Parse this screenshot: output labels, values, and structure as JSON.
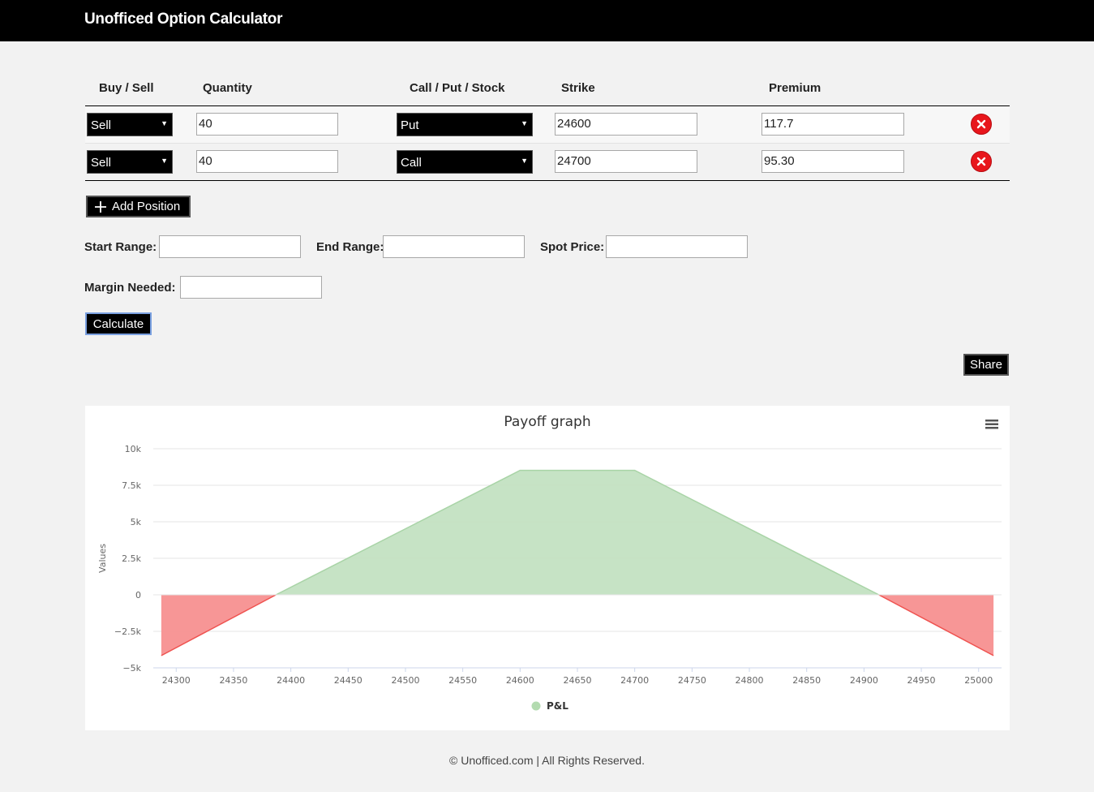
{
  "app": {
    "title": "Unofficed Option Calculator"
  },
  "table": {
    "headers": [
      "Buy / Sell",
      "Quantity",
      "Call / Put / Stock",
      "Strike",
      "Premium"
    ],
    "rows": [
      {
        "side": "Sell",
        "quantity": "40",
        "type": "Put",
        "strike": "24600",
        "premium": "117.7"
      },
      {
        "side": "Sell",
        "quantity": "40",
        "type": "Call",
        "strike": "24700",
        "premium": "95.30"
      }
    ]
  },
  "controls": {
    "add_position": "Add Position",
    "start_range": "Start Range:",
    "end_range": "End Range:",
    "spot_price": "Spot Price:",
    "margin_needed": "Margin Needed:",
    "calculate": "Calculate",
    "share": "Share"
  },
  "colors": {
    "profit": "#c3e1c2",
    "profit_line": "#a9d4a7",
    "loss": "#f79090",
    "loss_line": "#ef5350",
    "legend_dot": "#b3dbb0"
  },
  "chart_data": {
    "type": "area",
    "title": "Payoff graph",
    "ylabel": "Values",
    "xlim": [
      24280,
      25020
    ],
    "ylim": [
      -5000,
      10000
    ],
    "x_ticks": [
      24300,
      24350,
      24400,
      24450,
      24500,
      24550,
      24600,
      24650,
      24700,
      24750,
      24800,
      24850,
      24900,
      24950,
      25000
    ],
    "y_ticks": [
      10000,
      7500,
      5000,
      2500,
      0,
      -2500,
      -5000
    ],
    "y_tick_labels": [
      "10k",
      "7.5k",
      "5k",
      "2.5k",
      "0",
      "−2.5k",
      "−5k"
    ],
    "series": [
      {
        "name": "P&L",
        "x": [
          24287,
          24387,
          24600,
          24700,
          24913,
          25013
        ],
        "y": [
          -4160,
          0,
          8520,
          8520,
          0,
          -4160
        ]
      }
    ],
    "legend": "bottom-center"
  },
  "footer": "© Unofficed.com | All Rights Reserved."
}
